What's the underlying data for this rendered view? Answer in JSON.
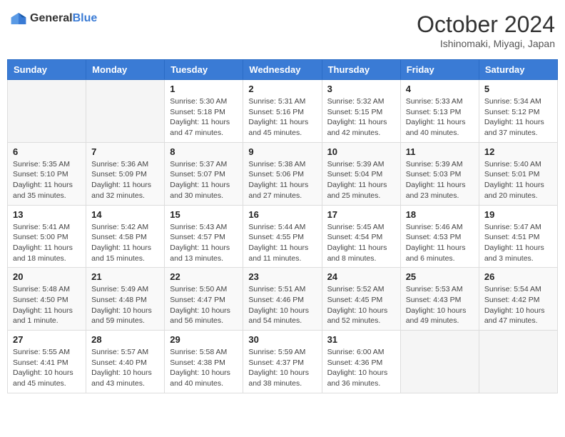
{
  "header": {
    "logo_general": "General",
    "logo_blue": "Blue",
    "month": "October 2024",
    "location": "Ishinomaki, Miyagi, Japan"
  },
  "weekdays": [
    "Sunday",
    "Monday",
    "Tuesday",
    "Wednesday",
    "Thursday",
    "Friday",
    "Saturday"
  ],
  "weeks": [
    [
      {
        "day": "",
        "info": ""
      },
      {
        "day": "",
        "info": ""
      },
      {
        "day": "1",
        "info": "Sunrise: 5:30 AM\nSunset: 5:18 PM\nDaylight: 11 hours and 47 minutes."
      },
      {
        "day": "2",
        "info": "Sunrise: 5:31 AM\nSunset: 5:16 PM\nDaylight: 11 hours and 45 minutes."
      },
      {
        "day": "3",
        "info": "Sunrise: 5:32 AM\nSunset: 5:15 PM\nDaylight: 11 hours and 42 minutes."
      },
      {
        "day": "4",
        "info": "Sunrise: 5:33 AM\nSunset: 5:13 PM\nDaylight: 11 hours and 40 minutes."
      },
      {
        "day": "5",
        "info": "Sunrise: 5:34 AM\nSunset: 5:12 PM\nDaylight: 11 hours and 37 minutes."
      }
    ],
    [
      {
        "day": "6",
        "info": "Sunrise: 5:35 AM\nSunset: 5:10 PM\nDaylight: 11 hours and 35 minutes."
      },
      {
        "day": "7",
        "info": "Sunrise: 5:36 AM\nSunset: 5:09 PM\nDaylight: 11 hours and 32 minutes."
      },
      {
        "day": "8",
        "info": "Sunrise: 5:37 AM\nSunset: 5:07 PM\nDaylight: 11 hours and 30 minutes."
      },
      {
        "day": "9",
        "info": "Sunrise: 5:38 AM\nSunset: 5:06 PM\nDaylight: 11 hours and 27 minutes."
      },
      {
        "day": "10",
        "info": "Sunrise: 5:39 AM\nSunset: 5:04 PM\nDaylight: 11 hours and 25 minutes."
      },
      {
        "day": "11",
        "info": "Sunrise: 5:39 AM\nSunset: 5:03 PM\nDaylight: 11 hours and 23 minutes."
      },
      {
        "day": "12",
        "info": "Sunrise: 5:40 AM\nSunset: 5:01 PM\nDaylight: 11 hours and 20 minutes."
      }
    ],
    [
      {
        "day": "13",
        "info": "Sunrise: 5:41 AM\nSunset: 5:00 PM\nDaylight: 11 hours and 18 minutes."
      },
      {
        "day": "14",
        "info": "Sunrise: 5:42 AM\nSunset: 4:58 PM\nDaylight: 11 hours and 15 minutes."
      },
      {
        "day": "15",
        "info": "Sunrise: 5:43 AM\nSunset: 4:57 PM\nDaylight: 11 hours and 13 minutes."
      },
      {
        "day": "16",
        "info": "Sunrise: 5:44 AM\nSunset: 4:55 PM\nDaylight: 11 hours and 11 minutes."
      },
      {
        "day": "17",
        "info": "Sunrise: 5:45 AM\nSunset: 4:54 PM\nDaylight: 11 hours and 8 minutes."
      },
      {
        "day": "18",
        "info": "Sunrise: 5:46 AM\nSunset: 4:53 PM\nDaylight: 11 hours and 6 minutes."
      },
      {
        "day": "19",
        "info": "Sunrise: 5:47 AM\nSunset: 4:51 PM\nDaylight: 11 hours and 3 minutes."
      }
    ],
    [
      {
        "day": "20",
        "info": "Sunrise: 5:48 AM\nSunset: 4:50 PM\nDaylight: 11 hours and 1 minute."
      },
      {
        "day": "21",
        "info": "Sunrise: 5:49 AM\nSunset: 4:48 PM\nDaylight: 10 hours and 59 minutes."
      },
      {
        "day": "22",
        "info": "Sunrise: 5:50 AM\nSunset: 4:47 PM\nDaylight: 10 hours and 56 minutes."
      },
      {
        "day": "23",
        "info": "Sunrise: 5:51 AM\nSunset: 4:46 PM\nDaylight: 10 hours and 54 minutes."
      },
      {
        "day": "24",
        "info": "Sunrise: 5:52 AM\nSunset: 4:45 PM\nDaylight: 10 hours and 52 minutes."
      },
      {
        "day": "25",
        "info": "Sunrise: 5:53 AM\nSunset: 4:43 PM\nDaylight: 10 hours and 49 minutes."
      },
      {
        "day": "26",
        "info": "Sunrise: 5:54 AM\nSunset: 4:42 PM\nDaylight: 10 hours and 47 minutes."
      }
    ],
    [
      {
        "day": "27",
        "info": "Sunrise: 5:55 AM\nSunset: 4:41 PM\nDaylight: 10 hours and 45 minutes."
      },
      {
        "day": "28",
        "info": "Sunrise: 5:57 AM\nSunset: 4:40 PM\nDaylight: 10 hours and 43 minutes."
      },
      {
        "day": "29",
        "info": "Sunrise: 5:58 AM\nSunset: 4:38 PM\nDaylight: 10 hours and 40 minutes."
      },
      {
        "day": "30",
        "info": "Sunrise: 5:59 AM\nSunset: 4:37 PM\nDaylight: 10 hours and 38 minutes."
      },
      {
        "day": "31",
        "info": "Sunrise: 6:00 AM\nSunset: 4:36 PM\nDaylight: 10 hours and 36 minutes."
      },
      {
        "day": "",
        "info": ""
      },
      {
        "day": "",
        "info": ""
      }
    ]
  ]
}
